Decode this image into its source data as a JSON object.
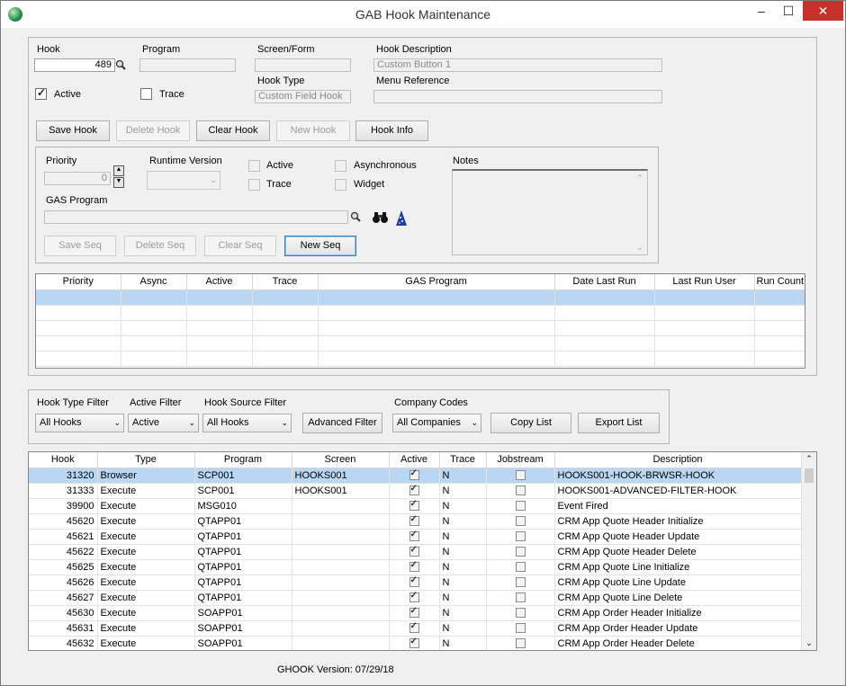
{
  "window": {
    "title": "GAB Hook Maintenance",
    "minimize": "–",
    "maximize": "☐",
    "close": "✕"
  },
  "hook_section": {
    "hook_label": "Hook",
    "hook_value": "489",
    "program_label": "Program",
    "program_value": "",
    "screen_label": "Screen/Form",
    "screen_value": "",
    "desc_label": "Hook Description",
    "desc_value": "Custom Button 1",
    "hook_type_label": "Hook Type",
    "hook_type_value": "Custom Field Hook",
    "menu_label": "Menu Reference",
    "menu_value": "",
    "active_label": "Active",
    "active_checked": true,
    "trace_label": "Trace",
    "trace_checked": false
  },
  "hook_buttons": {
    "save": "Save Hook",
    "delete": "Delete Hook",
    "clear": "Clear Hook",
    "new": "New Hook",
    "info": "Hook Info"
  },
  "seq_section": {
    "priority_label": "Priority",
    "priority_value": "0",
    "runtime_label": "Runtime Version",
    "runtime_value": "",
    "active_label": "Active",
    "trace_label": "Trace",
    "async_label": "Asynchronous",
    "widget_label": "Widget",
    "notes_label": "Notes",
    "gas_label": "GAS Program",
    "gas_value": "",
    "save": "Save Seq",
    "delete": "Delete Seq",
    "clear": "Clear Seq",
    "new": "New Seq"
  },
  "seq_grid": {
    "columns": [
      "Priority",
      "Async",
      "Active",
      "Trace",
      "GAS Program",
      "Date Last Run",
      "Last Run User",
      "Run Count"
    ]
  },
  "filters": {
    "type_label": "Hook Type Filter",
    "type_value": "All Hooks",
    "active_label": "Active Filter",
    "active_value": "Active",
    "source_label": "Hook Source Filter",
    "source_value": "All Hooks",
    "company_label": "Company Codes",
    "company_value": "All Companies",
    "advanced": "Advanced Filter",
    "copy": "Copy List",
    "export": "Export List"
  },
  "hook_list": {
    "columns": [
      "Hook",
      "Type",
      "Program",
      "Screen",
      "Active",
      "Trace",
      "Jobstream",
      "Description"
    ],
    "rows": [
      {
        "hook": "31320",
        "type": "Browser",
        "program": "SCP001",
        "screen": "HOOKS001",
        "active": true,
        "trace": "N",
        "jobstream": false,
        "desc": "HOOKS001-HOOK-BRWSR-HOOK"
      },
      {
        "hook": "31333",
        "type": "Execute",
        "program": "SCP001",
        "screen": "HOOKS001",
        "active": true,
        "trace": "N",
        "jobstream": false,
        "desc": "HOOKS001-ADVANCED-FILTER-HOOK"
      },
      {
        "hook": "39900",
        "type": "Execute",
        "program": "MSG010",
        "screen": "",
        "active": true,
        "trace": "N",
        "jobstream": false,
        "desc": "Event Fired"
      },
      {
        "hook": "45620",
        "type": "Execute",
        "program": "QTAPP01",
        "screen": "",
        "active": true,
        "trace": "N",
        "jobstream": false,
        "desc": "CRM App Quote Header Initialize"
      },
      {
        "hook": "45621",
        "type": "Execute",
        "program": "QTAPP01",
        "screen": "",
        "active": true,
        "trace": "N",
        "jobstream": false,
        "desc": "CRM App Quote Header Update"
      },
      {
        "hook": "45622",
        "type": "Execute",
        "program": "QTAPP01",
        "screen": "",
        "active": true,
        "trace": "N",
        "jobstream": false,
        "desc": "CRM App Quote Header Delete"
      },
      {
        "hook": "45625",
        "type": "Execute",
        "program": "QTAPP01",
        "screen": "",
        "active": true,
        "trace": "N",
        "jobstream": false,
        "desc": "CRM App Quote Line Initialize"
      },
      {
        "hook": "45626",
        "type": "Execute",
        "program": "QTAPP01",
        "screen": "",
        "active": true,
        "trace": "N",
        "jobstream": false,
        "desc": "CRM App Quote Line Update"
      },
      {
        "hook": "45627",
        "type": "Execute",
        "program": "QTAPP01",
        "screen": "",
        "active": true,
        "trace": "N",
        "jobstream": false,
        "desc": "CRM App Quote Line Delete"
      },
      {
        "hook": "45630",
        "type": "Execute",
        "program": "SOAPP01",
        "screen": "",
        "active": true,
        "trace": "N",
        "jobstream": false,
        "desc": "CRM App Order Header Initialize"
      },
      {
        "hook": "45631",
        "type": "Execute",
        "program": "SOAPP01",
        "screen": "",
        "active": true,
        "trace": "N",
        "jobstream": false,
        "desc": "CRM App Order Header Update"
      },
      {
        "hook": "45632",
        "type": "Execute",
        "program": "SOAPP01",
        "screen": "",
        "active": true,
        "trace": "N",
        "jobstream": false,
        "desc": "CRM App Order Header Delete"
      }
    ]
  },
  "footer": {
    "version": "GHOOK Version: 07/29/18"
  }
}
